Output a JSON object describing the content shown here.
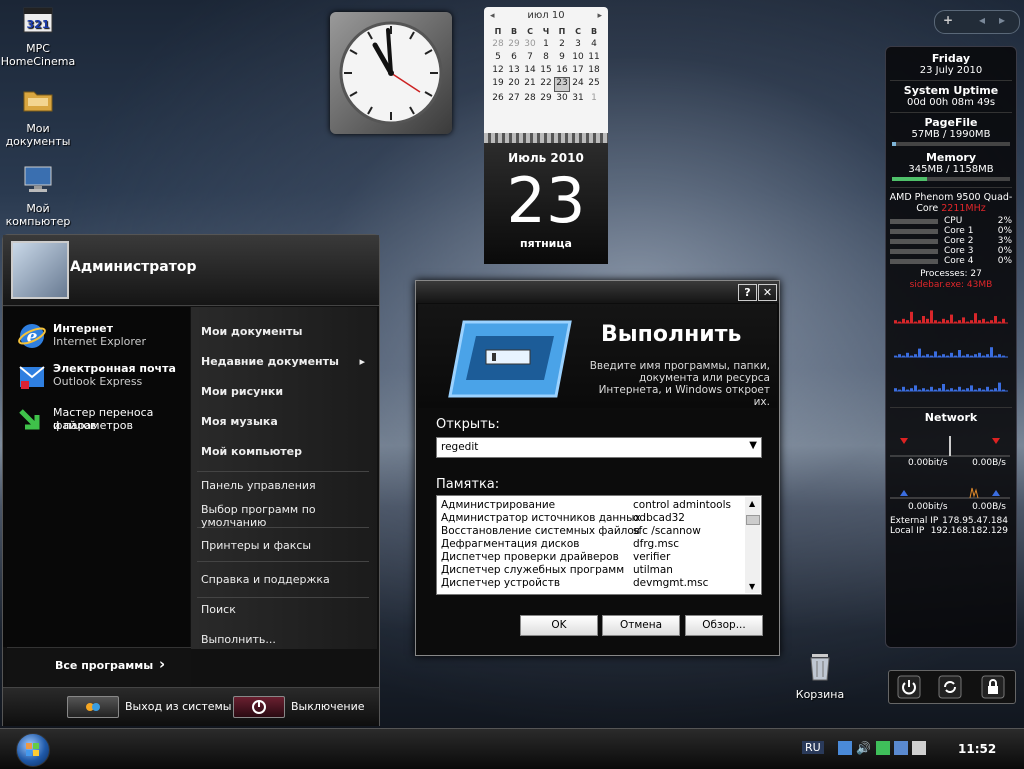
{
  "desktop_icons": [
    {
      "name": "mpc-homecinema",
      "label": "MPC HomeCinema",
      "icon": "mpc-icon"
    },
    {
      "name": "my-documents",
      "label": "Мои документы",
      "icon": "folder-icon"
    },
    {
      "name": "my-computer",
      "label": "Мой компьютер",
      "icon": "computer-icon"
    }
  ],
  "recycle_bin": {
    "label": "Корзина"
  },
  "calendar": {
    "header": "июл 10",
    "day_names": [
      "П",
      "В",
      "С",
      "Ч",
      "П",
      "С",
      "В"
    ],
    "weeks": [
      [
        {
          "d": "28",
          "o": true
        },
        {
          "d": "29",
          "o": true
        },
        {
          "d": "30",
          "o": true
        },
        {
          "d": "1"
        },
        {
          "d": "2"
        },
        {
          "d": "3"
        },
        {
          "d": "4"
        }
      ],
      [
        {
          "d": "5"
        },
        {
          "d": "6"
        },
        {
          "d": "7"
        },
        {
          "d": "8"
        },
        {
          "d": "9"
        },
        {
          "d": "10"
        },
        {
          "d": "11"
        }
      ],
      [
        {
          "d": "12"
        },
        {
          "d": "13"
        },
        {
          "d": "14"
        },
        {
          "d": "15"
        },
        {
          "d": "16"
        },
        {
          "d": "17"
        },
        {
          "d": "18"
        }
      ],
      [
        {
          "d": "19"
        },
        {
          "d": "20"
        },
        {
          "d": "21"
        },
        {
          "d": "22"
        },
        {
          "d": "23",
          "t": true
        },
        {
          "d": "24"
        },
        {
          "d": "25"
        }
      ],
      [
        {
          "d": "26"
        },
        {
          "d": "27"
        },
        {
          "d": "28"
        },
        {
          "d": "29"
        },
        {
          "d": "30"
        },
        {
          "d": "31"
        },
        {
          "d": "1",
          "o": true
        }
      ]
    ],
    "month_year": "Июль 2010",
    "day": "23",
    "weekday": "пятница"
  },
  "sidebar": {
    "day": "Friday",
    "date": "23 July 2010",
    "uptime_title": "System Uptime",
    "uptime": "00d 00h 08m 49s",
    "pagefile_title": "PageFile",
    "pagefile": "57MB / 1990MB",
    "pagefile_fill": 0.03,
    "memory_title": "Memory",
    "memory": "345MB / 1158MB",
    "memory_fill": 0.3,
    "cpu_name": "AMD Phenom 9500 Quad-Core",
    "cpu_freq": "2211MHz",
    "cores": [
      {
        "label": "CPU",
        "value": "2%"
      },
      {
        "label": "Core 1",
        "value": "0%"
      },
      {
        "label": "Core 2",
        "value": "3%"
      },
      {
        "label": "Core 3",
        "value": "0%"
      },
      {
        "label": "Core 4",
        "value": "0%"
      }
    ],
    "processes": "Processes: 27",
    "sidebar_exe": "sidebar.exe: 43MB",
    "network_title": "Network",
    "net_rx": "0.00bit/s",
    "net_tx": "0.00B/s",
    "net_rx2": "0.00bit/s",
    "net_tx2": "0.00B/s",
    "external_ip_label": "External IP",
    "external_ip": "178.95.47.184",
    "local_ip_label": "Local IP",
    "local_ip": "192.168.182.129"
  },
  "start_menu": {
    "user": "Администратор",
    "pinned": [
      {
        "title": "Интернет",
        "sub": "Internet Explorer",
        "icon": "internet-explorer-icon"
      },
      {
        "title": "Электронная почта",
        "sub": "Outlook Express",
        "icon": "outlook-express-icon"
      },
      {
        "title": "Мастер переноса файлов",
        "sub": "и параметров",
        "icon": "transfer-wizard-icon"
      }
    ],
    "right_items": [
      {
        "label": "Мои документы",
        "bold": true
      },
      {
        "label": "Недавние документы",
        "bold": true,
        "arrow": "▸"
      },
      {
        "label": "Мои рисунки",
        "bold": true
      },
      {
        "label": "Моя музыка",
        "bold": true
      },
      {
        "label": "Мой компьютер",
        "bold": true
      },
      {
        "label": "Панель управления"
      },
      {
        "label": "Выбор программ по умолчанию"
      },
      {
        "label": "Принтеры и факсы"
      },
      {
        "label": "Справка и поддержка"
      },
      {
        "label": "Поиск"
      },
      {
        "label": "Выполнить..."
      }
    ],
    "all_programs": "Все программы",
    "all_programs_arrow": "›",
    "logoff": "Выход из системы",
    "shutdown": "Выключение"
  },
  "run_dialog": {
    "help_button": "?",
    "close_button": "✕",
    "title": "Выполнить",
    "description": "Введите имя программы, папки, документа или ресурса Интернета, и Windows откроет их.",
    "open_label": "Открыть:",
    "open_value": "regedit",
    "memo_label": "Памятка:",
    "memo_rows": [
      {
        "name": "Администрирование",
        "cmd": "control admintools"
      },
      {
        "name": "Администратор источников данных",
        "cmd": "odbcad32"
      },
      {
        "name": "Восстановление системных файлов",
        "cmd": "sfc /scannow"
      },
      {
        "name": "Дефрагментация дисков",
        "cmd": "dfrg.msc"
      },
      {
        "name": "Диспетчер проверки драйверов",
        "cmd": "verifier"
      },
      {
        "name": "Диспетчер служебных программ",
        "cmd": "utilman"
      },
      {
        "name": "Диспетчер устройств",
        "cmd": "devmgmt.msc"
      }
    ],
    "ok": "OK",
    "cancel": "Отмена",
    "browse": "Обзор..."
  },
  "taskbar": {
    "language": "RU",
    "time": "11:52"
  },
  "sidebar_toolbar": {
    "add": "+",
    "prev": "◂",
    "next": "▸"
  },
  "chart_data": [
    {
      "type": "bar",
      "name": "cpu-history-red",
      "values": [
        2,
        1,
        3,
        2,
        8,
        1,
        2,
        5,
        3,
        9,
        2,
        1,
        3,
        2,
        6,
        1,
        2,
        4,
        1,
        2,
        7,
        2,
        3,
        1,
        2,
        5,
        1,
        3
      ]
    },
    {
      "type": "bar",
      "name": "core-history-blue-1",
      "values": [
        1,
        2,
        1,
        3,
        1,
        2,
        6,
        1,
        2,
        1,
        4,
        1,
        2,
        1,
        3,
        1,
        5,
        1,
        2,
        1,
        2,
        3,
        1,
        2,
        7,
        1,
        2,
        1
      ]
    },
    {
      "type": "bar",
      "name": "core-history-blue-2",
      "values": [
        2,
        1,
        3,
        1,
        2,
        4,
        1,
        2,
        1,
        3,
        1,
        2,
        5,
        1,
        2,
        1,
        3,
        1,
        2,
        4,
        1,
        2,
        1,
        3,
        1,
        2,
        6,
        1
      ]
    }
  ]
}
